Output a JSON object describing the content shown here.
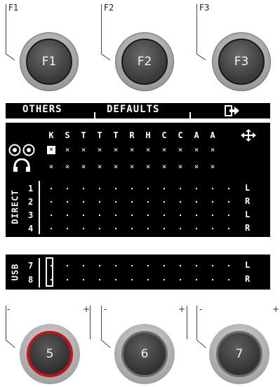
{
  "function_buttons": [
    {
      "corner_label": "F1",
      "button_label": "F1"
    },
    {
      "corner_label": "F2",
      "button_label": "F2"
    },
    {
      "corner_label": "F3",
      "button_label": "F3"
    }
  ],
  "tabs": {
    "others": "OTHERS",
    "defaults": "DEFAULTS",
    "exit_icon": "exit-arrow-icon"
  },
  "matrix": {
    "columns": [
      "K",
      "S",
      "T",
      "T",
      "T",
      "R",
      "H",
      "C",
      "C",
      "A",
      "A"
    ],
    "move_icon": "four-way-arrow-icon",
    "rows": [
      {
        "icon": "speakers-icon",
        "marks": [
          "selected",
          "x",
          "x",
          "x",
          "x",
          "x",
          "x",
          "x",
          "x",
          "x",
          "x"
        ]
      },
      {
        "icon": "headphones-icon",
        "marks": [
          "x",
          "x",
          "x",
          "x",
          "x",
          "x",
          "x",
          "x",
          "x",
          "x",
          "x"
        ]
      }
    ],
    "direct_label": "DIRECT",
    "direct_rows": [
      {
        "num": "1",
        "side": "L"
      },
      {
        "num": "2",
        "side": "R"
      },
      {
        "num": "3",
        "side": "L"
      },
      {
        "num": "4",
        "side": "R"
      }
    ],
    "usb_label": "USB",
    "usb_rows": [
      {
        "num": "7",
        "side": "L"
      },
      {
        "num": "8",
        "side": "R"
      }
    ]
  },
  "knobs": [
    {
      "label": "5",
      "minus": "-",
      "plus": "+",
      "active": true,
      "accent": "#c0161b"
    },
    {
      "label": "6",
      "minus": "-",
      "plus": "+",
      "active": false
    },
    {
      "label": "7",
      "minus": "-",
      "plus": "+",
      "active": false
    }
  ]
}
